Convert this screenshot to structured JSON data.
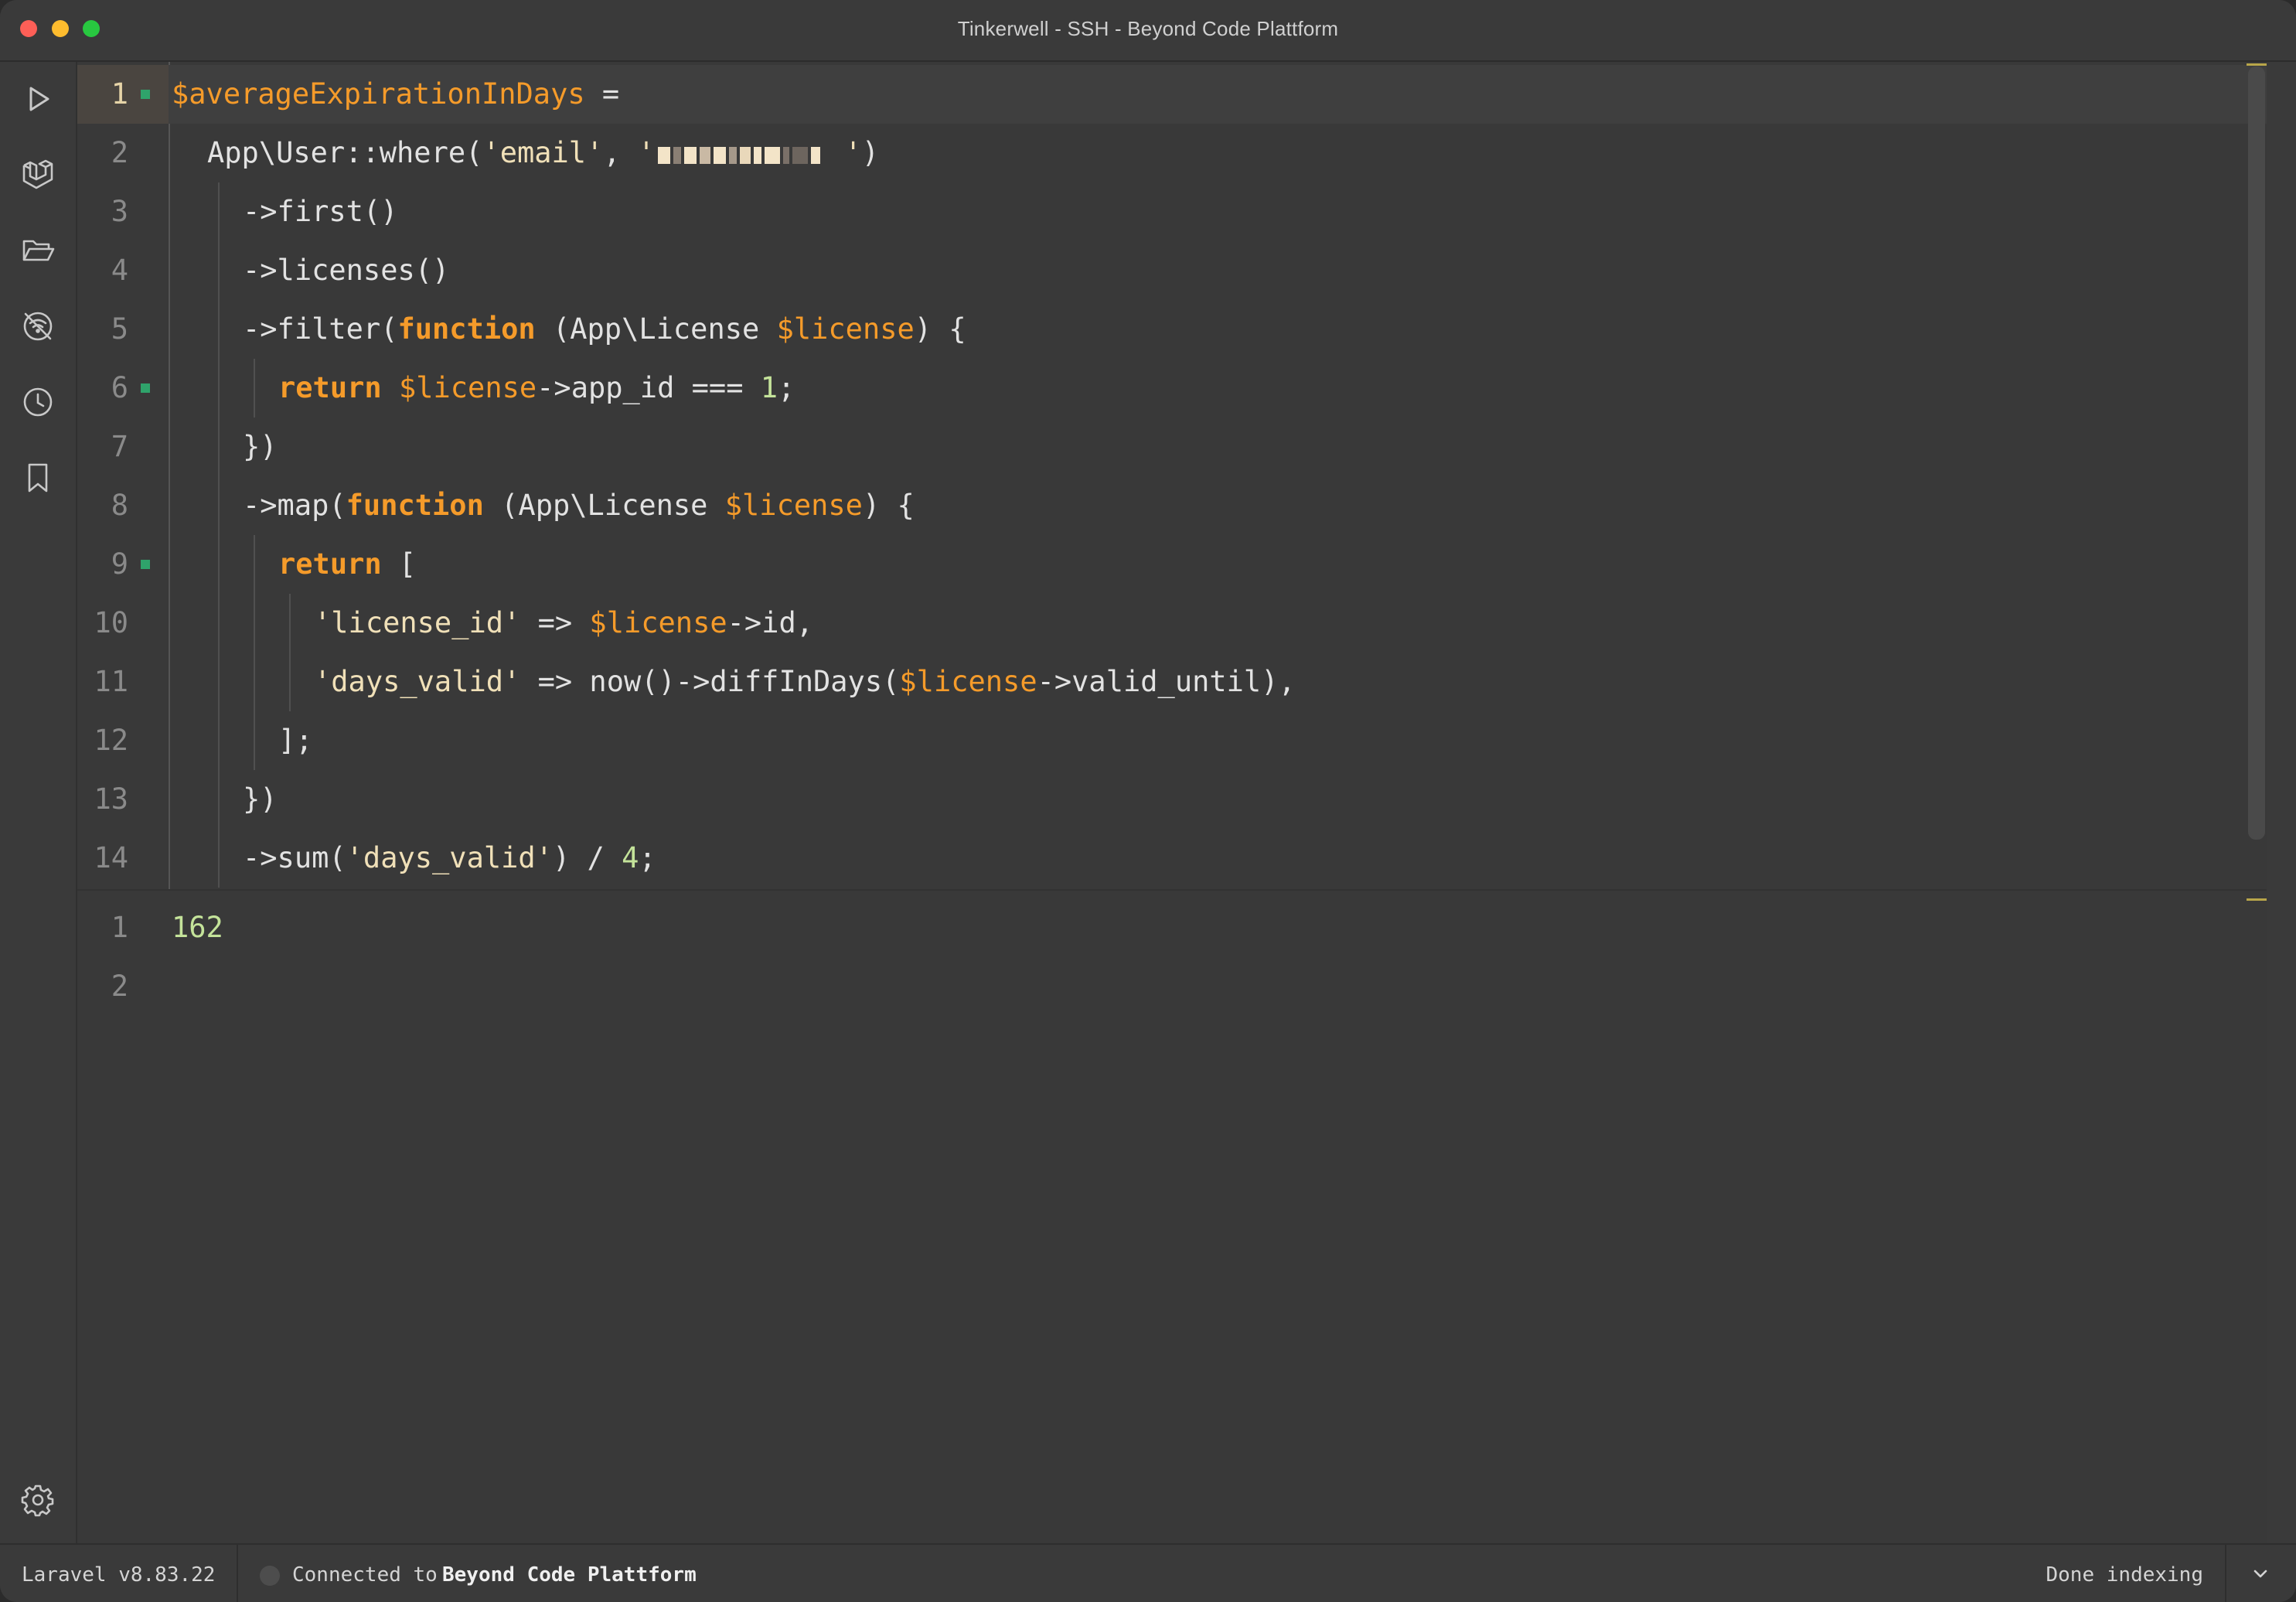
{
  "window": {
    "title": "Tinkerwell - SSH - Beyond Code Plattform"
  },
  "sidebar": {
    "icons": [
      "run-icon",
      "laravel-icon",
      "folder-open-icon",
      "no-signal-icon",
      "history-icon",
      "bookmark-icon",
      "settings-icon"
    ]
  },
  "editor": {
    "input_lines": [
      {
        "num": "1",
        "marked": true,
        "active": true,
        "indent": 0,
        "tokens": [
          {
            "t": "$averageExpirationInDays",
            "c": "var"
          },
          {
            "t": " =",
            "c": "plain"
          }
        ]
      },
      {
        "num": "2",
        "marked": false,
        "active": false,
        "indent": 1,
        "tokens": [
          {
            "t": "App\\User::where(",
            "c": "plain"
          },
          {
            "t": "'email'",
            "c": "str"
          },
          {
            "t": ", ",
            "c": "plain"
          },
          {
            "t": "'",
            "c": "str"
          },
          {
            "t": "[redacted-email]",
            "c": "redacted"
          },
          {
            "t": "'",
            "c": "str"
          },
          {
            "t": ")",
            "c": "plain"
          }
        ]
      },
      {
        "num": "3",
        "marked": false,
        "active": false,
        "indent": 2,
        "tokens": [
          {
            "t": "->first()",
            "c": "plain"
          }
        ]
      },
      {
        "num": "4",
        "marked": false,
        "active": false,
        "indent": 2,
        "tokens": [
          {
            "t": "->licenses()",
            "c": "plain"
          }
        ]
      },
      {
        "num": "5",
        "marked": false,
        "active": false,
        "indent": 2,
        "tokens": [
          {
            "t": "->filter(",
            "c": "plain"
          },
          {
            "t": "function",
            "c": "kw"
          },
          {
            "t": " (App\\License ",
            "c": "plain"
          },
          {
            "t": "$license",
            "c": "var"
          },
          {
            "t": ") {",
            "c": "plain"
          }
        ]
      },
      {
        "num": "6",
        "marked": true,
        "active": false,
        "indent": 3,
        "tokens": [
          {
            "t": "return",
            "c": "kw"
          },
          {
            "t": " ",
            "c": "plain"
          },
          {
            "t": "$license",
            "c": "var"
          },
          {
            "t": "->app_id === ",
            "c": "plain"
          },
          {
            "t": "1",
            "c": "num"
          },
          {
            "t": ";",
            "c": "plain"
          }
        ]
      },
      {
        "num": "7",
        "marked": false,
        "active": false,
        "indent": 2,
        "tokens": [
          {
            "t": "})",
            "c": "plain"
          }
        ]
      },
      {
        "num": "8",
        "marked": false,
        "active": false,
        "indent": 2,
        "tokens": [
          {
            "t": "->map(",
            "c": "plain"
          },
          {
            "t": "function",
            "c": "kw"
          },
          {
            "t": " (App\\License ",
            "c": "plain"
          },
          {
            "t": "$license",
            "c": "var"
          },
          {
            "t": ") {",
            "c": "plain"
          }
        ]
      },
      {
        "num": "9",
        "marked": true,
        "active": false,
        "indent": 3,
        "tokens": [
          {
            "t": "return",
            "c": "kw"
          },
          {
            "t": " [",
            "c": "plain"
          }
        ]
      },
      {
        "num": "10",
        "marked": false,
        "active": false,
        "indent": 4,
        "tokens": [
          {
            "t": "'license_id'",
            "c": "str"
          },
          {
            "t": " => ",
            "c": "plain"
          },
          {
            "t": "$license",
            "c": "var"
          },
          {
            "t": "->id,",
            "c": "plain"
          }
        ]
      },
      {
        "num": "11",
        "marked": false,
        "active": false,
        "indent": 4,
        "tokens": [
          {
            "t": "'days_valid'",
            "c": "str"
          },
          {
            "t": " => now()->diffInDays(",
            "c": "plain"
          },
          {
            "t": "$license",
            "c": "var"
          },
          {
            "t": "->valid_until),",
            "c": "plain"
          }
        ]
      },
      {
        "num": "12",
        "marked": false,
        "active": false,
        "indent": 3,
        "tokens": [
          {
            "t": "];",
            "c": "plain"
          }
        ]
      },
      {
        "num": "13",
        "marked": false,
        "active": false,
        "indent": 2,
        "tokens": [
          {
            "t": "})",
            "c": "plain"
          }
        ]
      },
      {
        "num": "14",
        "marked": false,
        "active": false,
        "indent": 2,
        "tokens": [
          {
            "t": "->sum(",
            "c": "plain"
          },
          {
            "t": "'days_valid'",
            "c": "str"
          },
          {
            "t": ") / ",
            "c": "plain"
          },
          {
            "t": "4",
            "c": "num"
          },
          {
            "t": ";",
            "c": "plain"
          }
        ]
      }
    ],
    "output_lines": [
      {
        "num": "1",
        "tokens": [
          {
            "t": "162",
            "c": "num"
          }
        ]
      },
      {
        "num": "2",
        "tokens": []
      }
    ]
  },
  "status": {
    "framework": "Laravel v8.83.22",
    "connection_prefix": "Connected to",
    "connection_target": "Beyond Code Plattform",
    "indexing": "Done indexing",
    "dropdown_icon": "chevron-down-icon"
  },
  "colors": {
    "background": "#393939",
    "keyword": "#f59b2a",
    "variable": "#f59b2a",
    "string": "#f0e0b8",
    "number": "#c4e39a",
    "gutter_marker": "#2fa36b"
  }
}
